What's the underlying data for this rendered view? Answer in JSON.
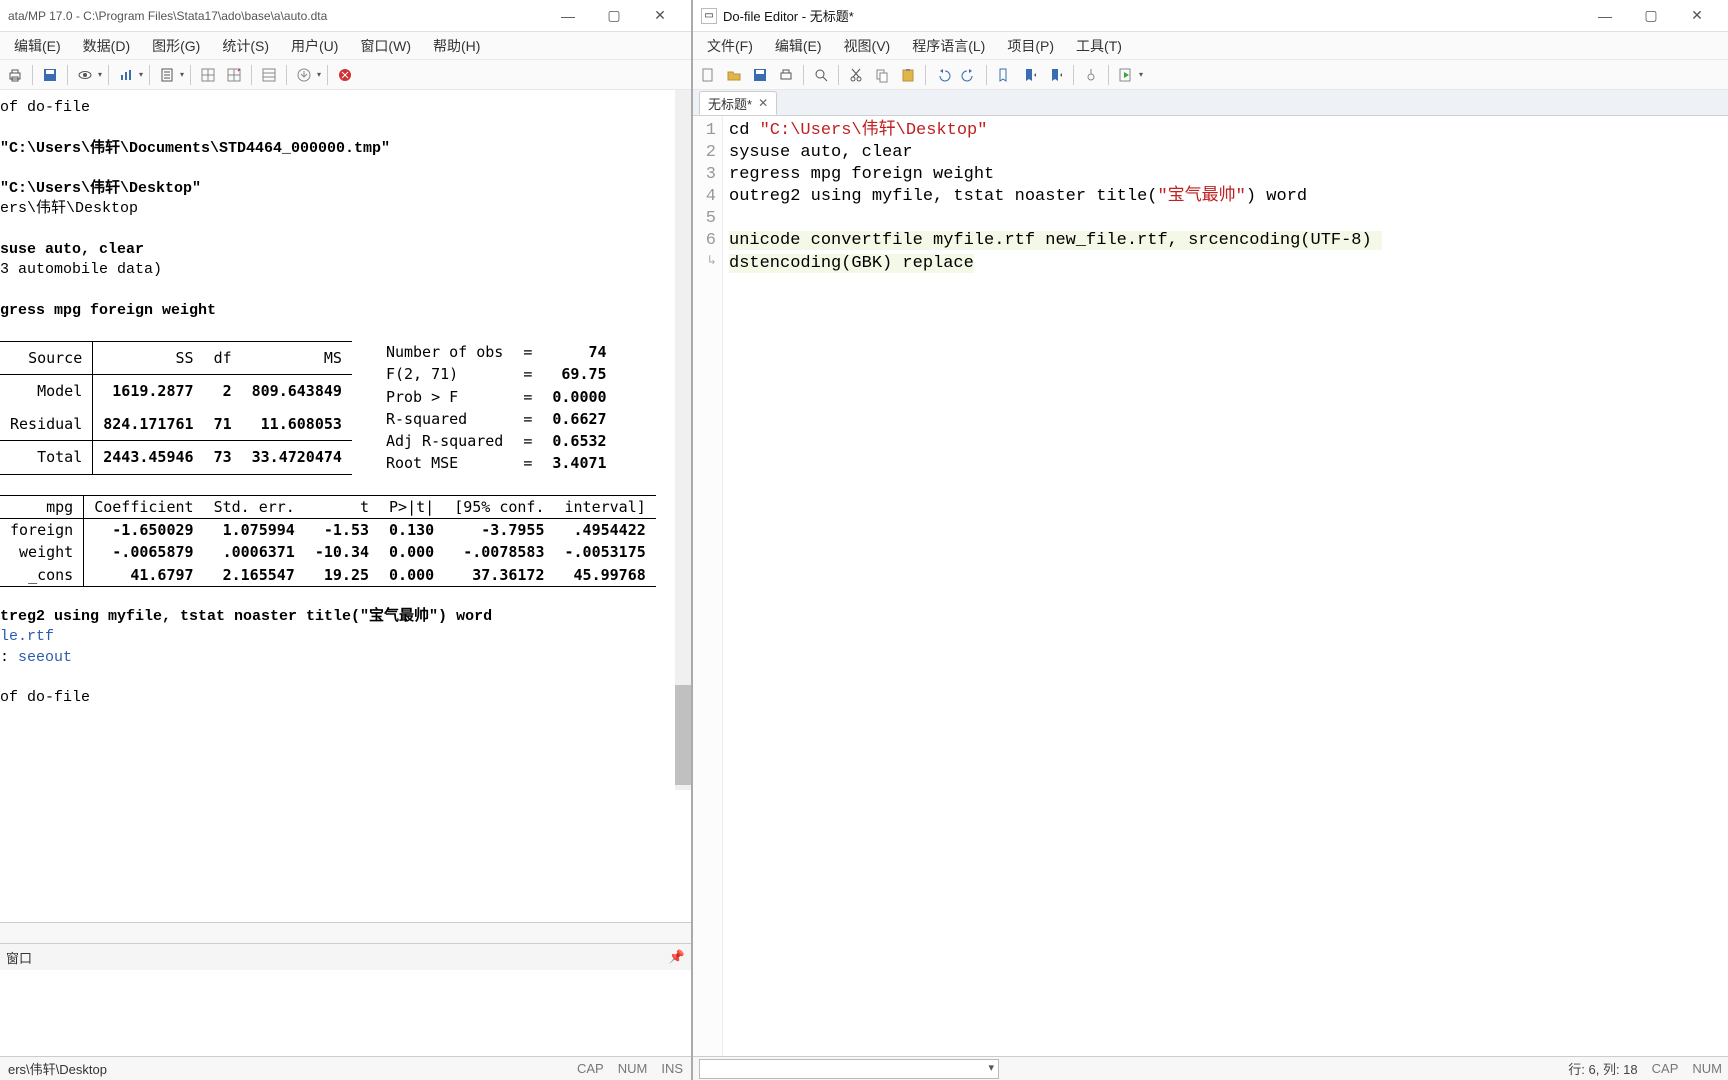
{
  "left": {
    "title": "ata/MP 17.0 - C:\\Program Files\\Stata17\\ado\\base\\a\\auto.dta",
    "menu": [
      "编辑(E)",
      "数据(D)",
      "图形(G)",
      "统计(S)",
      "用户(U)",
      "窗口(W)",
      "帮助(H)"
    ],
    "results": {
      "l1": "of do-file",
      "l2": "\"C:\\Users\\伟轩\\Documents\\STD4464_000000.tmp\"",
      "l3": "\"C:\\Users\\伟轩\\Desktop\"",
      "l4": "ers\\伟轩\\Desktop",
      "l5": "suse auto, clear",
      "l6": "3 automobile data)",
      "l7": "gress mpg foreign weight",
      "regstats": {
        "nobs_lbl": "Number of obs",
        "nobs": "74",
        "f_lbl": "F(2, 71)",
        "f": "69.75",
        "p_lbl": "Prob > F",
        "p": "0.0000",
        "r2_lbl": "R-squared",
        "r2": "0.6627",
        "ar2_lbl": "Adj R-squared",
        "ar2": "0.6532",
        "rmse_lbl": "Root MSE",
        "rmse": "3.4071"
      },
      "anova_hdr": [
        "Source",
        "SS",
        "df",
        "MS"
      ],
      "anova": [
        {
          "src": "Model",
          "ss": "1619.2877",
          "df": "2",
          "ms": "809.643849"
        },
        {
          "src": "Residual",
          "ss": "824.171761",
          "df": "71",
          "ms": "11.608053"
        },
        {
          "src": "Total",
          "ss": "2443.45946",
          "df": "73",
          "ms": "33.4720474"
        }
      ],
      "coef_hdr": [
        "mpg",
        "Coefficient",
        "Std. err.",
        "t",
        "P>|t|",
        "[95% conf.",
        "interval]"
      ],
      "coef": [
        {
          "v": "foreign",
          "c": "-1.650029",
          "se": "1.075994",
          "t": "-1.53",
          "p": "0.130",
          "lo": "-3.7955",
          "hi": ".4954422"
        },
        {
          "v": "weight",
          "c": "-.0065879",
          "se": ".0006371",
          "t": "-10.34",
          "p": "0.000",
          "lo": "-.0078583",
          "hi": "-.0053175"
        },
        {
          "v": "_cons",
          "c": "41.6797",
          "se": "2.165547",
          "t": "19.25",
          "p": "0.000",
          "lo": "37.36172",
          "hi": "45.99768"
        }
      ],
      "outreg": "treg2 using myfile, tstat noaster title(\"宝气最帅\") word",
      "outreg_link1": "le.rtf",
      "outreg_link2": "seeout",
      "lend": "of do-file"
    },
    "cmd_panel": "窗口",
    "statusbar_path": "ers\\伟轩\\Desktop",
    "status_inds": [
      "CAP",
      "NUM",
      "INS"
    ]
  },
  "right": {
    "title": "Do-file Editor - 无标题*",
    "menu": [
      "文件(F)",
      "编辑(E)",
      "视图(V)",
      "程序语言(L)",
      "项目(P)",
      "工具(T)"
    ],
    "tab": "无标题*",
    "code_l1a": "cd ",
    "code_l1b": "\"C:\\Users\\伟轩\\Desktop\"",
    "code_l2": "sysuse auto, clear",
    "code_l3": "regress mpg foreign weight",
    "code_l4a": "outreg2 using myfile, tstat noaster title(",
    "code_l4b": "\"宝气最帅\"",
    "code_l4c": ") word",
    "code_l6": "unicode convertfile myfile.rtf new_file.rtf, srcencoding(UTF-8) ",
    "code_l7": "dstencoding(GBK) replace",
    "status_pos": "行: 6, 列: 18",
    "status_inds": [
      "CAP",
      "NUM"
    ]
  }
}
